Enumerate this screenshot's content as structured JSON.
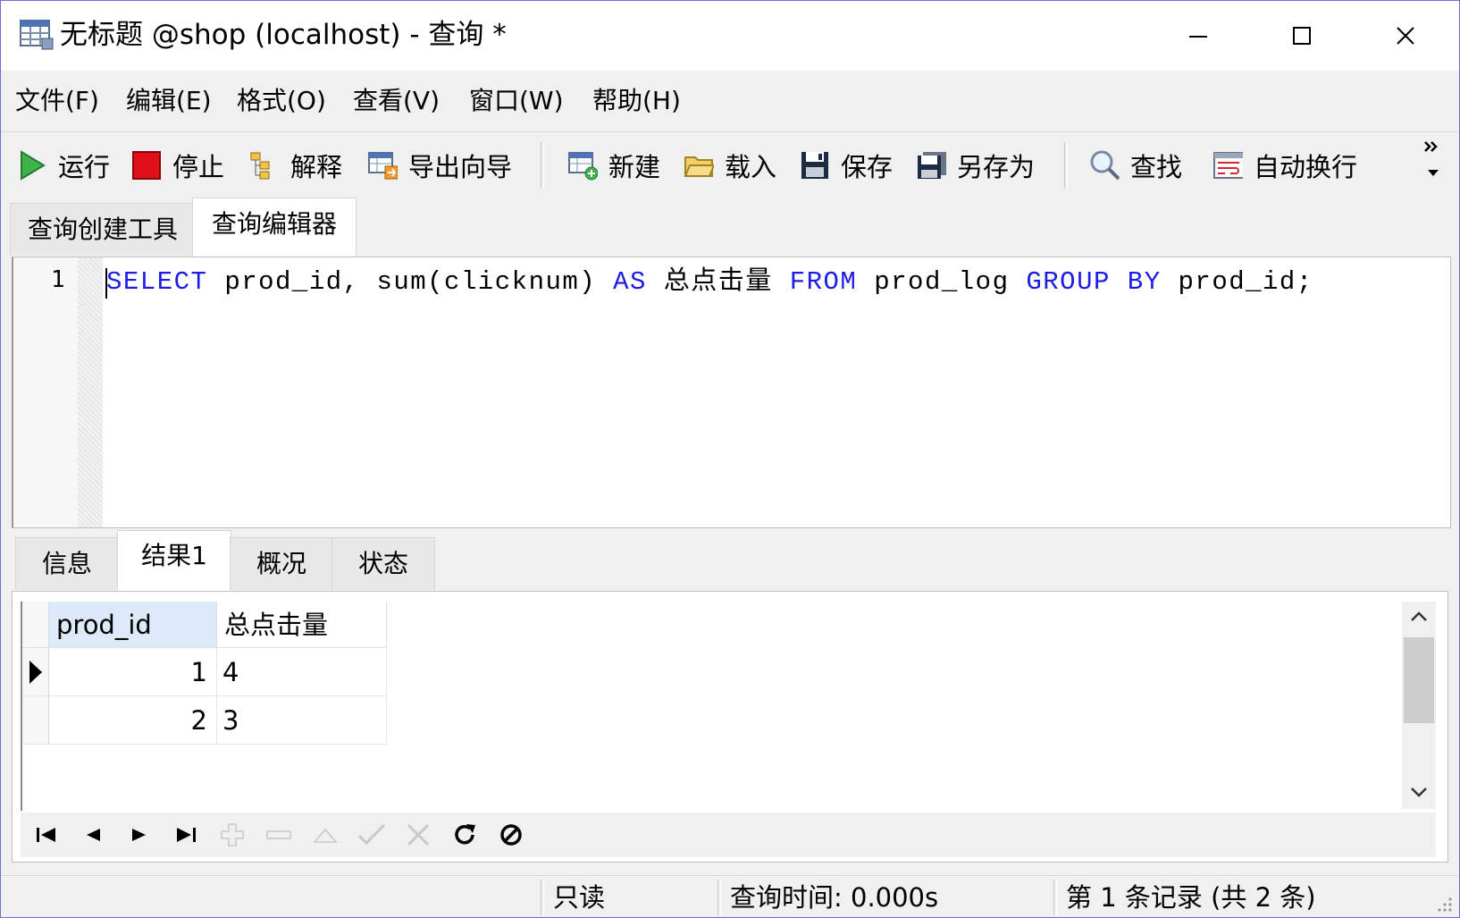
{
  "window": {
    "title": "无标题 @shop (localhost) - 查询 *"
  },
  "menu": [
    "文件(F)",
    "编辑(E)",
    "格式(O)",
    "查看(V)",
    "窗口(W)",
    "帮助(H)"
  ],
  "toolbar": {
    "run": "运行",
    "stop": "停止",
    "explain": "解释",
    "export_wizard": "导出向导",
    "new": "新建",
    "load": "载入",
    "save": "保存",
    "save_as": "另存为",
    "find": "查找",
    "word_wrap": "自动换行"
  },
  "editor_tabs": [
    "查询创建工具",
    "查询编辑器"
  ],
  "editor": {
    "line_number": "1",
    "tokens": [
      {
        "t": "SELECT",
        "kw": true
      },
      {
        "t": " prod_id, sum(clicknum) ",
        "kw": false
      },
      {
        "t": "AS",
        "kw": true
      },
      {
        "t": " 总点击量 ",
        "kw": false
      },
      {
        "t": "FROM",
        "kw": true
      },
      {
        "t": " prod_log ",
        "kw": false
      },
      {
        "t": "GROUP BY",
        "kw": true
      },
      {
        "t": " prod_id;",
        "kw": false
      }
    ]
  },
  "result_tabs": [
    "信息",
    "结果1",
    "概况",
    "状态"
  ],
  "grid": {
    "columns": [
      "prod_id",
      "总点击量"
    ],
    "rows": [
      [
        "1",
        "4"
      ],
      [
        "2",
        "3"
      ]
    ]
  },
  "status": {
    "readonly": "只读",
    "query_time": "查询时间: 0.000s",
    "record": "第 1 条记录 (共 2 条)"
  },
  "colors": {
    "keyword": "#1c1ce6",
    "header_selected": "#dbe9f8",
    "window_border": "#6f6fd8"
  }
}
